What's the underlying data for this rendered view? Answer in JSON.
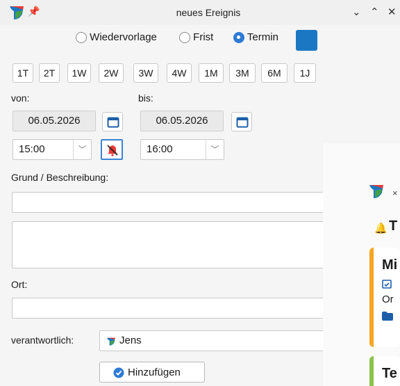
{
  "window": {
    "title": "neues Ereignis",
    "controls": {
      "minimize": "⌄",
      "maximize": "⌃",
      "close": "✕"
    }
  },
  "type_select": {
    "options": [
      {
        "label": "Wiedervorlage",
        "selected": false
      },
      {
        "label": "Frist",
        "selected": false
      },
      {
        "label": "Termin",
        "selected": true
      }
    ],
    "color": "#1c77c3"
  },
  "quick_buttons": [
    "1T",
    "2T",
    "1W",
    "2W",
    "3W",
    "4W",
    "1M",
    "3M",
    "6M",
    "1J"
  ],
  "from": {
    "label": "von:",
    "date": "06.05.2026",
    "time": "15:00"
  },
  "to": {
    "label": "bis:",
    "date": "06.05.2026",
    "time": "16:00"
  },
  "reason_label": "Grund / Beschreibung:",
  "location_label": "Ort:",
  "responsible": {
    "label": "verantwortlich:",
    "value": "Jens"
  },
  "add_button": "Hinzufügen",
  "overlay": {
    "heading_fragment": "T",
    "card1_title_fragment": "Mi",
    "card1_text_fragment": "Or",
    "card2_title_fragment": "Te",
    "card1_accent": "#f5a623",
    "card2_accent": "#8bc34a"
  }
}
